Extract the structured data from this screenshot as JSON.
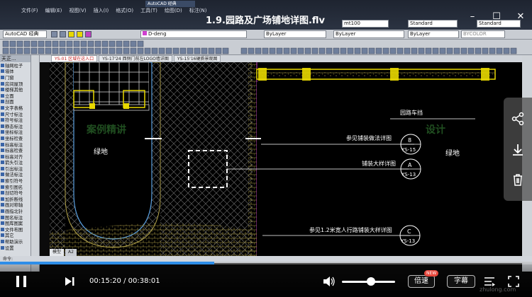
{
  "video": {
    "title": "1.9.园路及广场铺地详图.flv",
    "current_time": "00:15:20",
    "total_time": "00:38:01",
    "time_display": "00:15:20 / 00:38:01",
    "progress": 0.403,
    "volume": 0.55,
    "speed_label": "倍速",
    "speed_badge": "NEW",
    "subtitle_label": "字幕",
    "watermark": "zhulong.com"
  },
  "cad": {
    "menu": [
      "文件(F)",
      "编辑(E)",
      "视图(V)",
      "插入(I)",
      "格式(O)",
      "工具(T)",
      "绘图(D)",
      "标注(N)"
    ],
    "app_tab": "AutoCAD 经典",
    "workspace": "AutoCAD 经典",
    "layer": "D-deng",
    "color": "ByLayer",
    "linetype": "ByLayer",
    "lineweight": "ByLayer",
    "plotstyle": "BYCOLOR",
    "text_style": "Standard",
    "dim_style": "mt100",
    "table_style": "Standard",
    "multileader_style": "Standard",
    "panel_title": "天正...",
    "left_panel_items": [
      "轴网柱子",
      "墙体",
      "门窗",
      "房间屋顶",
      "楼梯其他",
      "立面",
      "剖面",
      "文字表格",
      "尺寸标注",
      "符号标注",
      "静态标注",
      "坐标标注",
      "坐标检查",
      "标高标注",
      "标高检查",
      "标高对齐",
      "箭头引注",
      "引出标注",
      "做法标注",
      "索引符号",
      "索引图名",
      "剖切符号",
      "加折断线",
      "画对称轴",
      "画指北针",
      "图名标注",
      "图库图案",
      "文件布图",
      "其它",
      "帮助演示",
      "设置"
    ],
    "tabs": [
      "YS-01 区域在这入口",
      "YS-17'24 西侧门前左LOGO墙详图",
      "YS-15'16硬质景观图"
    ],
    "model_tabs": [
      "模型",
      "A2"
    ],
    "drawing_labels": {
      "green_left": "绿地",
      "green_right": "绿地",
      "car_stop": "园路车挡",
      "note1": "参见铺装做法详图",
      "note2": "铺装大样详图",
      "note3": "参见1.2米宽人行路铺装大样详图",
      "circle1_top": "8",
      "circle1_bottom": "YS-15",
      "circle2_top": "A",
      "circle2_bottom": "YS-13",
      "circle3_top": "C",
      "circle3_bottom": "YS-13",
      "overlay_left": "案例精讲",
      "overlay_right": "设计"
    },
    "command_line": "命令:"
  },
  "side_actions": [
    "share-icon",
    "download-icon",
    "delete-icon"
  ],
  "colors": {
    "accent": "#2e8ee8",
    "cad_yellow": "#e8d800",
    "hatch": "#6e6e6e",
    "badge": "#e7473c"
  }
}
